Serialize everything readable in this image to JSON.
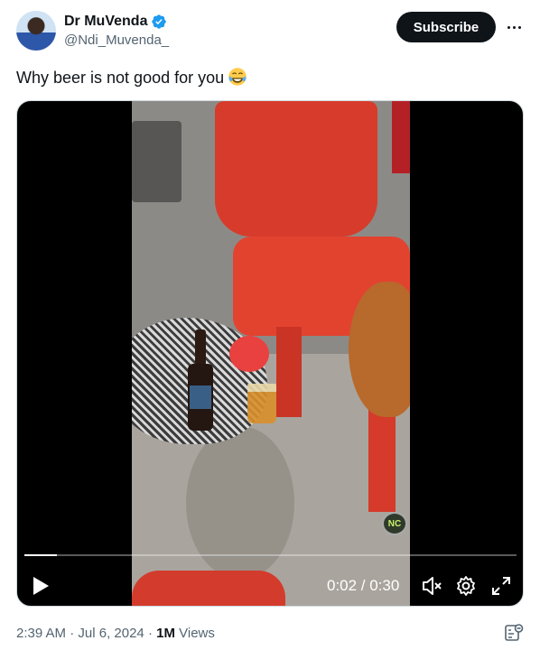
{
  "author": {
    "display_name": "Dr MuVenda",
    "handle": "@Ndi_Muvenda_",
    "verified_icon": "verified-badge-icon",
    "verified_color": "#1d9bf0"
  },
  "actions": {
    "subscribe_label": "Subscribe",
    "more_icon": "more-horizontal-icon"
  },
  "tweet": {
    "text": "Why beer is not good for you",
    "emoji": "face-with-tears-of-joy"
  },
  "video": {
    "current_time": "0:02",
    "separator": "/",
    "duration": "0:30",
    "time_display": "0:02 / 0:30",
    "progress_fraction": 0.066,
    "watermark": "NC",
    "controls": [
      "play-icon",
      "mute-icon",
      "settings-icon",
      "fullscreen-icon"
    ]
  },
  "meta": {
    "time": "2:39 AM",
    "date": "Jul 6, 2024",
    "views_count": "1M",
    "views_label": "Views"
  },
  "colors": {
    "text_primary": "#0f1419",
    "text_secondary": "#536471",
    "button_bg": "#0f1419"
  }
}
